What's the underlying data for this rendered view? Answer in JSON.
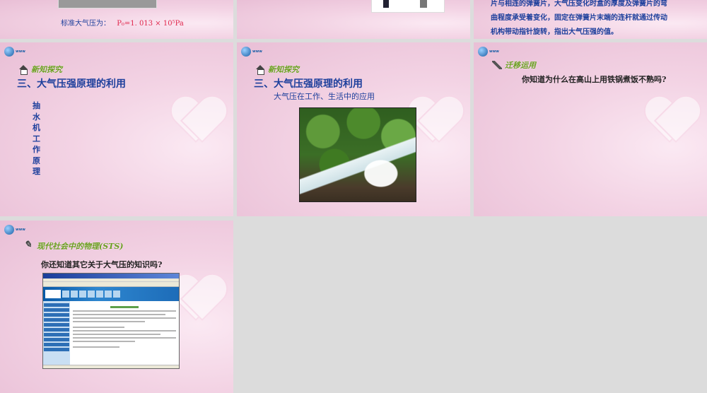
{
  "slides": {
    "s1": {
      "body": "标准大气压为：",
      "formula": "P₀=1. 013 × 10⁵Pa"
    },
    "s3": {
      "line1": "片与相连的弹簧片，大气压变化时盒的厚度及弹簧片的弯",
      "line2": "曲程度承受着变化，固定在弹簧片末端的连杆就通过传动",
      "line3": "机构带动指针旋转，指出大气压强的值。"
    },
    "s4": {
      "section": "新知探究",
      "title": "三、大气压强原理的利用",
      "vertical": "抽水机工作原理"
    },
    "s5": {
      "section": "新知探究",
      "title": "三、大气压强原理的利用",
      "subtitle": "大气压在工作、生活中的应用"
    },
    "s6": {
      "section": "迁移运用",
      "question": "你知道为什么在高山上用铁锅煮饭不熟吗?"
    },
    "s7": {
      "section": "现代社会中的物理(STS)",
      "question": "你还知道其它关于大气压的知识吗?"
    }
  },
  "colors": {
    "title": "#1d3f9c",
    "section": "#6b9d20",
    "formula": "#e0264c",
    "slide_bg": "#f3d3e4",
    "page_bg": "#dcdcdc"
  },
  "icons": [
    "house-icon",
    "pencil-icon",
    "sts-icon",
    "globe-logo-icon",
    "heart-decoration"
  ]
}
